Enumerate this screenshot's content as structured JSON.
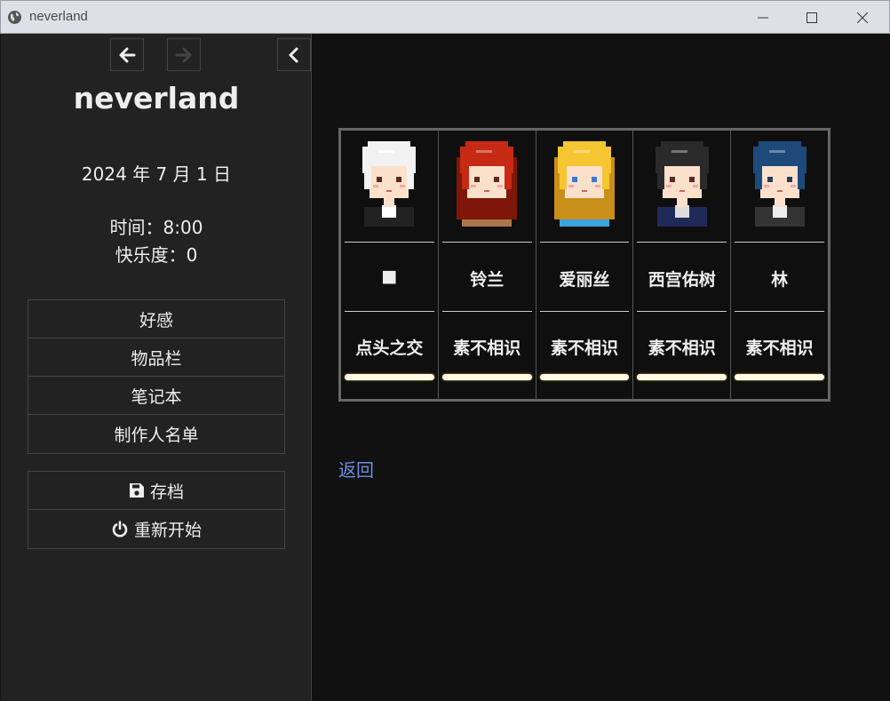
{
  "window": {
    "title": "neverland"
  },
  "sidebar": {
    "story_title": "neverland",
    "date": "2024 年 7 月 1 日",
    "time": "时间：8:00",
    "happiness": "快乐度：0",
    "menu": [
      "好感",
      "物品栏",
      "笔记本",
      "制作人名单"
    ],
    "save_label": "存档",
    "restart_label": "重新开始"
  },
  "characters": [
    {
      "name": "■",
      "relation": "点头之交",
      "hair": "#f2f2f2",
      "hair_dark": "#bbbbbb",
      "cloth": "#222222",
      "collar": "#ffffff"
    },
    {
      "name": "铃兰",
      "relation": "素不相识",
      "hair": "#c72a14",
      "hair_dark": "#7e1709",
      "cloth": "#a8774a",
      "collar": "#d8b08a"
    },
    {
      "name": "爱丽丝",
      "relation": "素不相识",
      "hair": "#f6c632",
      "hair_dark": "#c8901a",
      "cloth": "#3aa4e0",
      "collar": "#d8eefa"
    },
    {
      "name": "西宫佑树",
      "relation": "素不相识",
      "hair": "#2a2a2a",
      "hair_dark": "#101010",
      "cloth": "#1f2a5a",
      "collar": "#dddddd"
    },
    {
      "name": "林",
      "relation": "素不相识",
      "hair": "#1d4a7a",
      "hair_dark": "#0d2a4a",
      "cloth": "#333333",
      "collar": "#eeeeee"
    }
  ],
  "affection_levels": [
    1,
    1,
    1,
    1,
    1
  ],
  "main": {
    "back_link": "返回"
  }
}
